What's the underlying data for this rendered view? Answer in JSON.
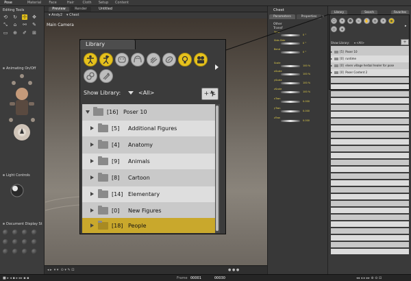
{
  "rooms": [
    {
      "label": "Pose",
      "active": true
    },
    {
      "label": "Material",
      "active": false
    },
    {
      "label": "Face",
      "active": false
    },
    {
      "label": "Hair",
      "active": false
    },
    {
      "label": "Cloth",
      "active": false
    },
    {
      "label": "Setup",
      "active": false
    },
    {
      "label": "Content",
      "active": false
    }
  ],
  "left": {
    "editing_tools": "Editing Tools",
    "animating": "Animating On/Off",
    "light_controls": "Light Controls",
    "document_display": "Document Display St"
  },
  "viewport": {
    "tabs": [
      "Preview",
      "Render"
    ],
    "doc_title": "Untitled",
    "figure_select": "Andy2",
    "actor_select": "Chest",
    "camera_label": "Main Camera"
  },
  "parameters": {
    "actor": "Chest",
    "tabs": [
      "Parameters",
      "Properties"
    ],
    "group": "Other",
    "group2": "Transf",
    "dials": [
      {
        "label": "Twist",
        "value": "0 °"
      },
      {
        "label": "Side-Side",
        "value": "0 °"
      },
      {
        "label": "Bend",
        "value": "0 °"
      },
      {
        "label": "Scale",
        "value": "100 %"
      },
      {
        "label": "xScale",
        "value": "100 %"
      },
      {
        "label": "yScale",
        "value": "100 %"
      },
      {
        "label": "zScale",
        "value": "100 %"
      },
      {
        "label": "xTran",
        "value": "0.000"
      },
      {
        "label": "yTran",
        "value": "0.000"
      },
      {
        "label": "zTran",
        "value": "0.000"
      }
    ]
  },
  "right_library": {
    "tabs": [
      "Library",
      "Search",
      "Favorites"
    ],
    "show_label": "Show Library:",
    "show_value": "<All>",
    "items": [
      {
        "count": "[5]",
        "name": "Poser 10"
      },
      {
        "count": "[0]",
        "name": "runtime"
      },
      {
        "count": "[0]",
        "name": "elven village herbal healer for pose"
      },
      {
        "count": "[0]",
        "name": "Poser Content 2"
      }
    ]
  },
  "popup": {
    "tab_label": "Library",
    "show_label": "Show Library:",
    "show_value": "<All>",
    "add_label": "+",
    "tree": [
      {
        "count": "[16]",
        "name": "Poser 10",
        "level": 0,
        "expanded": true,
        "selected": false
      },
      {
        "count": "[5]",
        "name": "Additional Figures",
        "level": 1,
        "expanded": false,
        "selected": false
      },
      {
        "count": "[4]",
        "name": "Anatomy",
        "level": 1,
        "expanded": false,
        "selected": false
      },
      {
        "count": "[9]",
        "name": "Animals",
        "level": 1,
        "expanded": false,
        "selected": false
      },
      {
        "count": "[8]",
        "name": "Cartoon",
        "level": 1,
        "expanded": false,
        "selected": false
      },
      {
        "count": "[14]",
        "name": "Elementary",
        "level": 1,
        "expanded": false,
        "selected": false
      },
      {
        "count": "[0]",
        "name": "New Figures",
        "level": 1,
        "expanded": false,
        "selected": false
      },
      {
        "count": "[18]",
        "name": "People",
        "level": 1,
        "expanded": false,
        "selected": true
      }
    ]
  },
  "bottom": {
    "frame_label": "Frame",
    "frame_value": "00001",
    "frame_total": "00030"
  },
  "colors": {
    "accent": "#e6c21d",
    "selected_row": "#c9a82c"
  }
}
